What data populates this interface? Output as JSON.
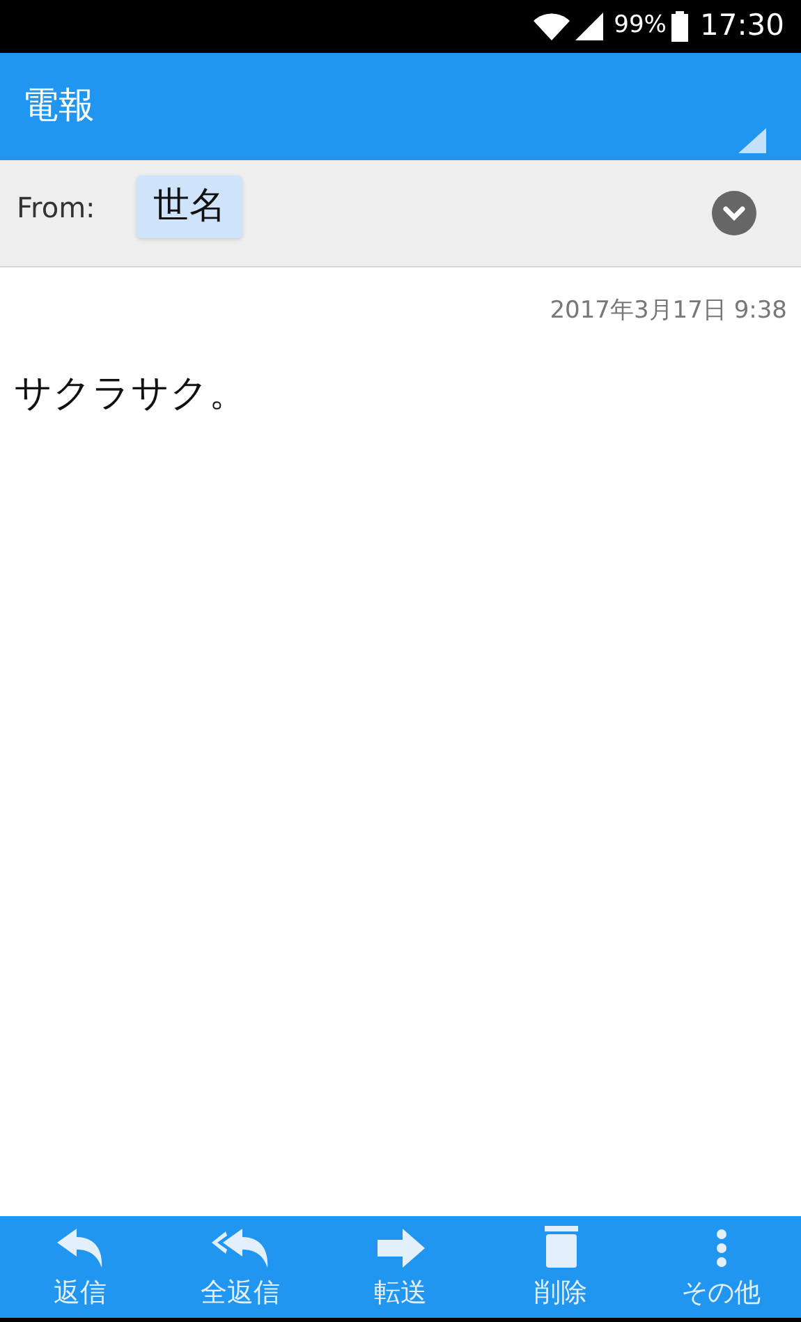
{
  "status_bar": {
    "battery": "99%",
    "time": "17:30"
  },
  "header": {
    "title": "電報"
  },
  "from": {
    "label": "From:",
    "sender": "世名"
  },
  "message": {
    "date": "2017年3月17日 9:38",
    "body": "サクラサク。"
  },
  "toolbar": [
    {
      "kind": "reply",
      "label": "返信"
    },
    {
      "kind": "reply_all",
      "label": "全返信"
    },
    {
      "kind": "forward",
      "label": "転送"
    },
    {
      "kind": "delete",
      "label": "削除"
    },
    {
      "kind": "more",
      "label": "その他"
    }
  ]
}
